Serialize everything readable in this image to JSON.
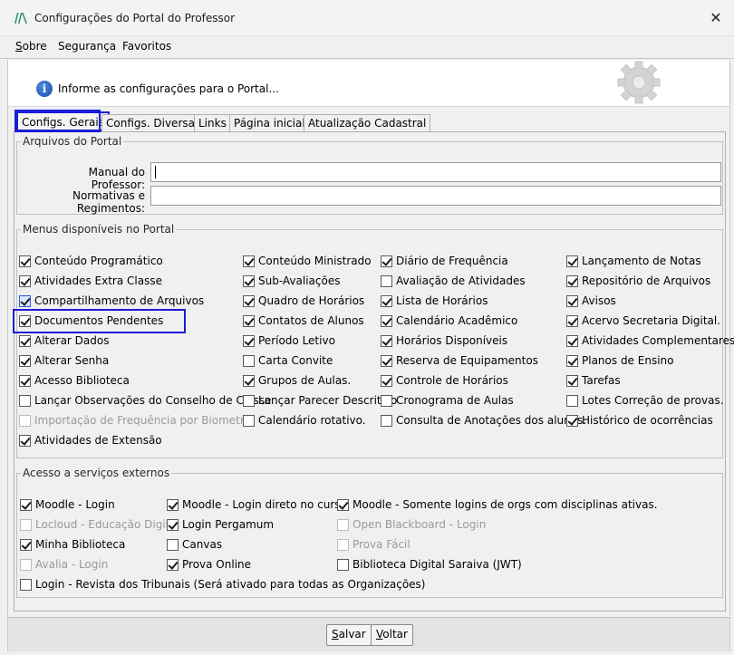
{
  "window": {
    "title": "Configurações do Portal do Professor",
    "close_glyph": "✕"
  },
  "menubar": {
    "items": [
      {
        "mnemonic": "S",
        "rest": "obre"
      },
      {
        "mnemonic": "",
        "rest": "Segurança"
      },
      {
        "mnemonic": "",
        "rest": "Favoritos"
      }
    ]
  },
  "banner": {
    "text": "Informe as configurações para o Portal...",
    "info_glyph": "i"
  },
  "tabs": [
    "Configs. Gerais",
    "Configs. Diversas",
    "Links",
    "Página inicial",
    "Atualização Cadastral"
  ],
  "arquivos": {
    "legend": "Arquivos do Portal",
    "manual_label": "Manual do Professor:",
    "manual_value": "",
    "normativas_label": "Normativas e Regimentos:",
    "normativas_value": ""
  },
  "menus": {
    "legend": "Menus disponíveis no Portal",
    "columns": [
      [
        {
          "label": "Conteúdo Programático",
          "checked": true
        },
        {
          "label": "Atividades Extra Classe",
          "checked": true
        },
        {
          "label": "Compartilhamento de Arquivos",
          "checked": true,
          "focused": true
        },
        {
          "label": "Documentos Pendentes",
          "checked": true
        },
        {
          "label": "Alterar Dados",
          "checked": true
        },
        {
          "label": "Alterar Senha",
          "checked": true
        },
        {
          "label": "Acesso Biblioteca",
          "checked": true
        },
        {
          "label": "Lançar Observações do Conselho de Classe",
          "checked": false
        },
        {
          "label": "Importação de Frequência por Biometria",
          "checked": false,
          "disabled": true
        },
        {
          "label": "Atividades de Extensão",
          "checked": true
        }
      ],
      [
        {
          "label": "Conteúdo Ministrado",
          "checked": true
        },
        {
          "label": "Sub-Avaliações",
          "checked": true
        },
        {
          "label": "Quadro de Horários",
          "checked": true
        },
        {
          "label": "Contatos de Alunos",
          "checked": true
        },
        {
          "label": "Período Letivo",
          "checked": true
        },
        {
          "label": "Carta Convite",
          "checked": false
        },
        {
          "label": "Grupos de Aulas.",
          "checked": true
        },
        {
          "label": "Lançar Parecer Descritivo",
          "checked": false
        },
        {
          "label": "Calendário rotativo.",
          "checked": false
        }
      ],
      [
        {
          "label": "Diário de Frequência",
          "checked": true
        },
        {
          "label": "Avaliação de Atividades",
          "checked": false
        },
        {
          "label": "Lista de Horários",
          "checked": true
        },
        {
          "label": "Calendário Acadêmico",
          "checked": true
        },
        {
          "label": "Horários Disponíveis",
          "checked": true
        },
        {
          "label": "Reserva de Equipamentos",
          "checked": true
        },
        {
          "label": "Controle de Horários",
          "checked": true
        },
        {
          "label": "Cronograma de Aulas",
          "checked": false
        },
        {
          "label": "Consulta de Anotações dos alunos.",
          "checked": false
        }
      ],
      [
        {
          "label": "Lançamento de Notas",
          "checked": true
        },
        {
          "label": "Repositório de Arquivos",
          "checked": true
        },
        {
          "label": "Avisos",
          "checked": true
        },
        {
          "label": "Acervo Secretaria Digital.",
          "checked": true
        },
        {
          "label": "Atividades Complementares",
          "checked": true
        },
        {
          "label": "Planos de Ensino",
          "checked": true
        },
        {
          "label": "Tarefas",
          "checked": true
        },
        {
          "label": "Lotes Correção de provas.",
          "checked": false
        },
        {
          "label": "Histórico de ocorrências",
          "checked": true
        }
      ]
    ]
  },
  "externos": {
    "legend": "Acesso a serviços externos",
    "columns": [
      [
        {
          "label": "Moodle - Login",
          "checked": true
        },
        {
          "label": "Locloud - Educação Digital",
          "checked": false,
          "disabled": true
        },
        {
          "label": "Minha Biblioteca",
          "checked": true
        },
        {
          "label": "Avalia - Login",
          "checked": false,
          "disabled": true
        },
        {
          "label": "Login - Revista dos Tribunais (Será ativado para todas as Organizações)",
          "checked": false
        }
      ],
      [
        {
          "label": "Moodle - Login direto no curso.",
          "checked": true
        },
        {
          "label": "Login Pergamum",
          "checked": true
        },
        {
          "label": "Canvas",
          "checked": false
        },
        {
          "label": "Prova Online",
          "checked": true
        }
      ],
      [
        {
          "label": "Moodle - Somente logins de orgs com disciplinas ativas.",
          "checked": true
        },
        {
          "label": "Open Blackboard - Login",
          "checked": false,
          "disabled": true
        },
        {
          "label": "Prova Fácil",
          "checked": false,
          "disabled": true
        },
        {
          "label": "Biblioteca Digital Saraiva (JWT)",
          "checked": false
        }
      ]
    ]
  },
  "footer": {
    "salvar": {
      "mnemonic": "S",
      "rest": "alvar"
    },
    "voltar": {
      "mnemonic": "V",
      "rest": "oltar"
    }
  }
}
